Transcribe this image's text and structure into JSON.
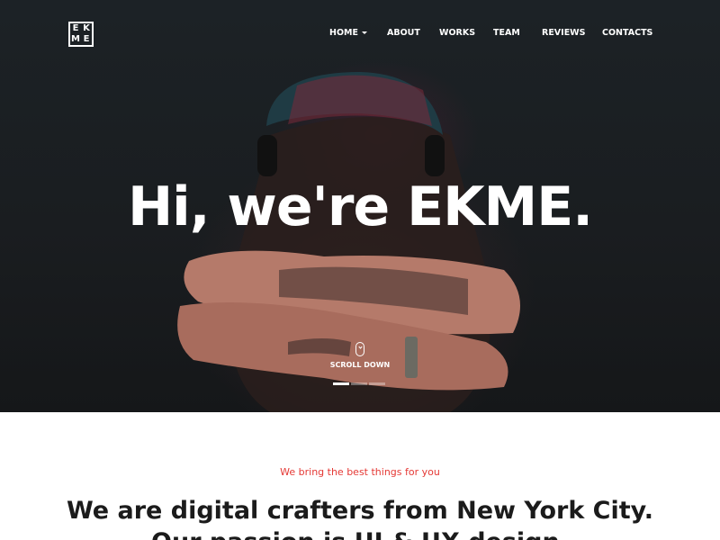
{
  "logo": {
    "letters": [
      "E",
      "K",
      "M",
      "E"
    ]
  },
  "nav": {
    "items": [
      {
        "label": "HOME",
        "has_dropdown": true
      },
      {
        "label": "ABOUT"
      },
      {
        "label": "WORKS"
      },
      {
        "label": "TEAM"
      },
      {
        "label": "REVIEWS"
      },
      {
        "label": "CONTACTS"
      }
    ]
  },
  "hero": {
    "headline": "Hi, we're EKME.",
    "scroll_label": "SCROLL DOWN",
    "slider": {
      "slides": 3,
      "active_index": 0
    }
  },
  "intro": {
    "tagline": "We bring the best things for you",
    "title_line1": "We are digital crafters from New York City.",
    "title_line2": "Our passion is UI & UX design."
  },
  "icons": {
    "logo": "ekme-logo",
    "dropdown": "caret-down-icon",
    "scroll": "mouse-icon"
  },
  "colors": {
    "accent": "#e53935",
    "hero_bg": "#1b1f22",
    "text": "#1b1b1b"
  }
}
